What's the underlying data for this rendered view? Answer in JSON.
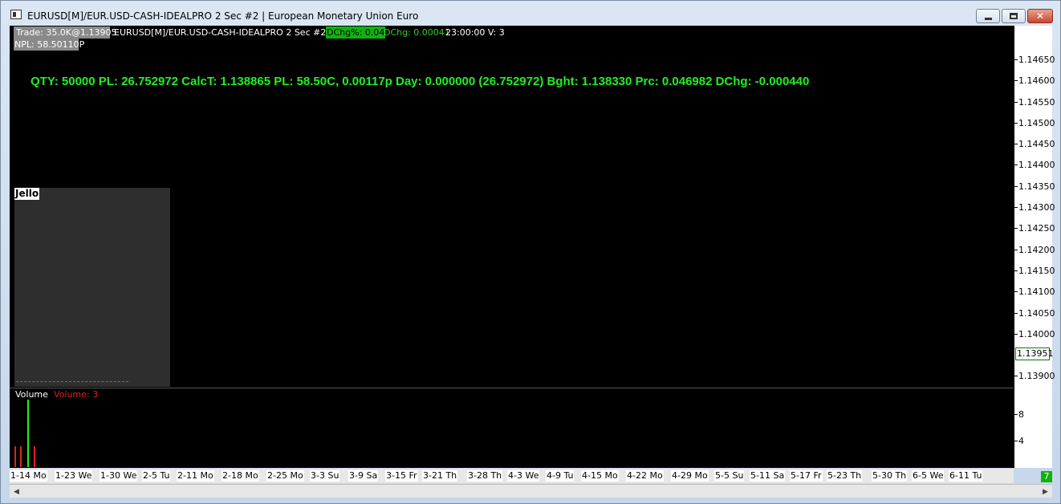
{
  "window": {
    "title": "EURUSD[M]/EUR.USD-CASH-IDEALPRO  2 Sec   #2 | European Monetary Union Euro"
  },
  "header": {
    "trade": "Trade: 35.0K@1.13905",
    "npl": "NPL: 58.50110P",
    "symbol": "EURUSD[M]/EUR.USD-CASH-IDEALPRO  2 Sec   #2",
    "dchg_pct": "DChg%: 0.04",
    "dchg": "DChg: 0.00041",
    "time_volume": "23:00:00 V: 3"
  },
  "position_line": "QTY: 50000  PL: 26.752972 CalcT: 1.138865 PL: 58.50C, 0.00117p Day: 0.000000 (26.752972) Bght: 1.138330 Prc: 0.046982 DChg: -0.000440",
  "jello": {
    "label": "Jello"
  },
  "volume": {
    "title": "Volume",
    "value": "Volume: 3"
  },
  "price_axis": {
    "ticks": [
      "1.14650",
      "1.14600",
      "1.14550",
      "1.14500",
      "1.14450",
      "1.14400",
      "1.14350",
      "1.14300",
      "1.14250",
      "1.14200",
      "1.14150",
      "1.14100",
      "1.14050",
      "1.14000",
      "1.13900"
    ],
    "current": "1.13951",
    "volume_ticks": [
      "8",
      "4"
    ]
  },
  "time_axis": {
    "labels": [
      "1-14 Mo",
      "1-23 We",
      "1-30 We",
      "2-5 Tu",
      "2-11 Mo",
      "2-18 Mo",
      "2-25 Mo",
      "3-3 Su",
      "3-9 Sa",
      "3-15 Fr",
      "3-21 Th",
      "3-28 Th",
      "4-3 We",
      "4-9 Tu",
      "4-15 Mo",
      "4-22 Mo",
      "4-29 Mo",
      "5-5 Su",
      "5-11 Sa",
      "5-17 Fr",
      "5-23 Th",
      "5-30 Th",
      "6-5 We",
      "6-11 Tu"
    ]
  },
  "corner_badge": "7",
  "colors": {
    "green": "#22ee22",
    "red": "#e02020",
    "background": "#000000"
  }
}
